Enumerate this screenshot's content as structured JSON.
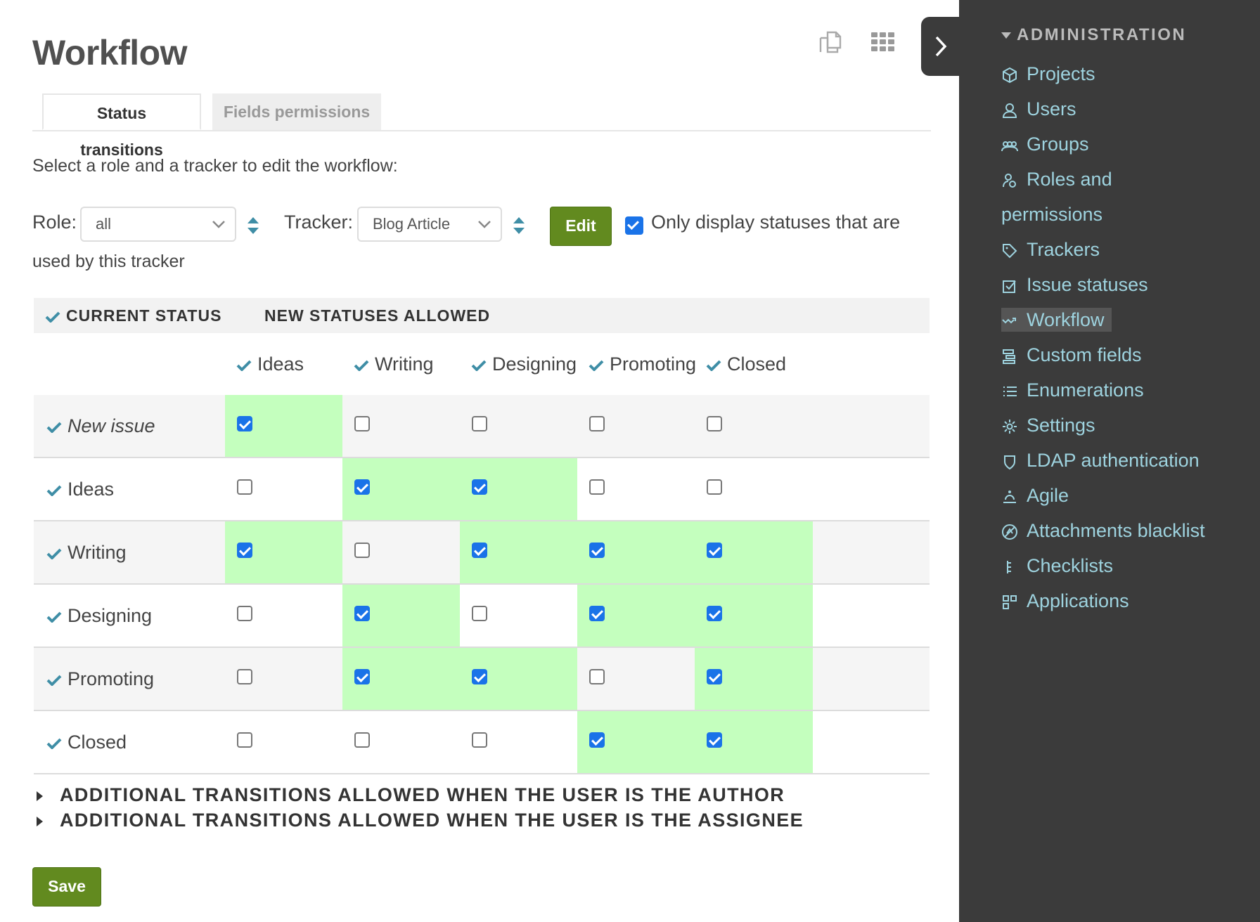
{
  "page": {
    "title": "Workflow"
  },
  "tabs": [
    {
      "label": "Status transitions"
    },
    {
      "label": "Fields permissions"
    }
  ],
  "form": {
    "instructions": "Select a role and a tracker to edit the workflow:",
    "role_label": "Role:",
    "role_value": "all",
    "tracker_label": "Tracker:",
    "tracker_value": "Blog Article",
    "edit_label": "Edit",
    "only_display_checked": true,
    "only_display_text": "Only display statuses that are",
    "only_display_text_2": "used by this tracker"
  },
  "table": {
    "current_status_header": "CURRENT STATUS",
    "new_statuses_header": "NEW STATUSES ALLOWED",
    "columns": [
      "Ideas",
      "Writing",
      "Designing",
      "Promoting",
      "Closed"
    ],
    "rows": [
      {
        "label": "New issue",
        "italic": true,
        "values": [
          true,
          false,
          false,
          false,
          false
        ]
      },
      {
        "label": "Ideas",
        "values": [
          false,
          true,
          true,
          false,
          false
        ]
      },
      {
        "label": "Writing",
        "values": [
          true,
          false,
          true,
          true,
          true
        ]
      },
      {
        "label": "Designing",
        "values": [
          false,
          true,
          false,
          true,
          true
        ]
      },
      {
        "label": "Promoting",
        "values": [
          false,
          true,
          true,
          false,
          true
        ]
      },
      {
        "label": "Closed",
        "values": [
          false,
          false,
          false,
          true,
          true
        ]
      }
    ]
  },
  "additional": {
    "author": "ADDITIONAL TRANSITIONS ALLOWED WHEN THE USER IS THE AUTHOR",
    "assignee": "ADDITIONAL TRANSITIONS ALLOWED WHEN THE USER IS THE ASSIGNEE"
  },
  "save_label": "Save",
  "sidebar": {
    "heading": "ADMINISTRATION",
    "items": [
      {
        "label": "Projects",
        "icon": "cube-icon"
      },
      {
        "label": "Users",
        "icon": "user-icon"
      },
      {
        "label": "Groups",
        "icon": "group-icon"
      },
      {
        "label": "Roles and",
        "label2": "permissions",
        "icon": "roles-icon"
      },
      {
        "label": "Trackers",
        "icon": "tag-icon"
      },
      {
        "label": "Issue statuses",
        "icon": "checkbox-icon"
      },
      {
        "label": "Workflow",
        "icon": "workflow-icon",
        "selected": true
      },
      {
        "label": "Custom fields",
        "icon": "custom-fields-icon"
      },
      {
        "label": "Enumerations",
        "icon": "list-icon"
      },
      {
        "label": "Settings",
        "icon": "gear-icon"
      },
      {
        "label": "LDAP authentication",
        "icon": "shield-icon"
      },
      {
        "label": "Agile",
        "icon": "agile-icon"
      },
      {
        "label": "Attachments blacklist",
        "icon": "blacklist-icon"
      },
      {
        "label": "Checklists",
        "icon": "checklist-icon"
      },
      {
        "label": "Applications",
        "icon": "applications-icon"
      }
    ]
  },
  "colors": {
    "accent_green": "#628a1f",
    "allowed_cell": "#c4ffbe",
    "sidebar_bg": "#3b3b3b",
    "sidebar_link": "#9ed3df",
    "checkbox_blue": "#1a73e8",
    "tick_teal": "#3f8ea6"
  }
}
